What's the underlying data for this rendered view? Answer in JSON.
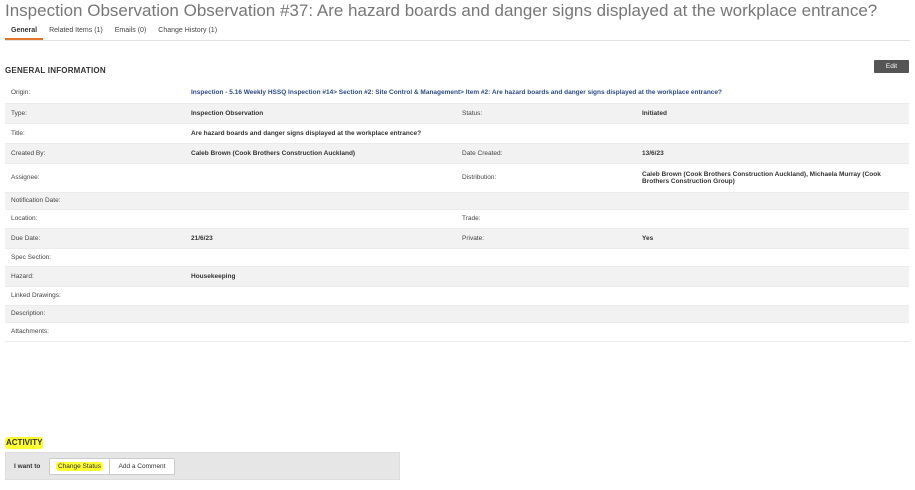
{
  "page": {
    "title": "Inspection Observation Observation #37: Are hazard boards and danger signs displayed at the workplace entrance?"
  },
  "tabs": [
    {
      "label": "General",
      "active": true
    },
    {
      "label": "Related Items (1)",
      "active": false
    },
    {
      "label": "Emails (0)",
      "active": false
    },
    {
      "label": "Change History (1)",
      "active": false
    }
  ],
  "general": {
    "header": "GENERAL INFORMATION",
    "edit_label": "Edit",
    "origin_label": "Origin:",
    "origin_value": "Inspection - 5.16 Weekly HSSQ Inspection #14> Section #2: Site Control & Management> Item #2: Are hazard boards and danger signs displayed at the workplace entrance?",
    "type_label": "Type:",
    "type_value": "Inspection Observation",
    "status_label": "Status:",
    "status_value": "Initiated",
    "title_label": "Title:",
    "title_value": "Are hazard boards and danger signs displayed at the workplace entrance?",
    "created_by_label": "Created By:",
    "created_by_value": "Caleb Brown (Cook Brothers Construction Auckland)",
    "date_created_label": "Date Created:",
    "date_created_value": "13/6/23",
    "assignee_label": "Assignee:",
    "assignee_value": "",
    "distribution_label": "Distribution:",
    "distribution_value": "Caleb Brown (Cook Brothers Construction Auckland), Michaela Murray (Cook Brothers Construction Group)",
    "notification_date_label": "Notification Date:",
    "location_label": "Location:",
    "trade_label": "Trade:",
    "due_date_label": "Due Date:",
    "due_date_value": "21/6/23",
    "private_label": "Private:",
    "private_value": "Yes",
    "spec_section_label": "Spec Section:",
    "hazard_label": "Hazard:",
    "hazard_value": "Housekeeping",
    "linked_drawings_label": "Linked Drawings:",
    "description_label": "Description:",
    "attachments_label": "Attachments:"
  },
  "activity": {
    "header": "ACTIVITY",
    "i_want_to": "I want to",
    "change_status": "Change Status",
    "add_comment": "Add a Comment"
  },
  "colors": {
    "tab_active": "#e0752d",
    "link": "#2c4a8a",
    "highlight": "#fdfd33",
    "edit_button": "#555555"
  }
}
